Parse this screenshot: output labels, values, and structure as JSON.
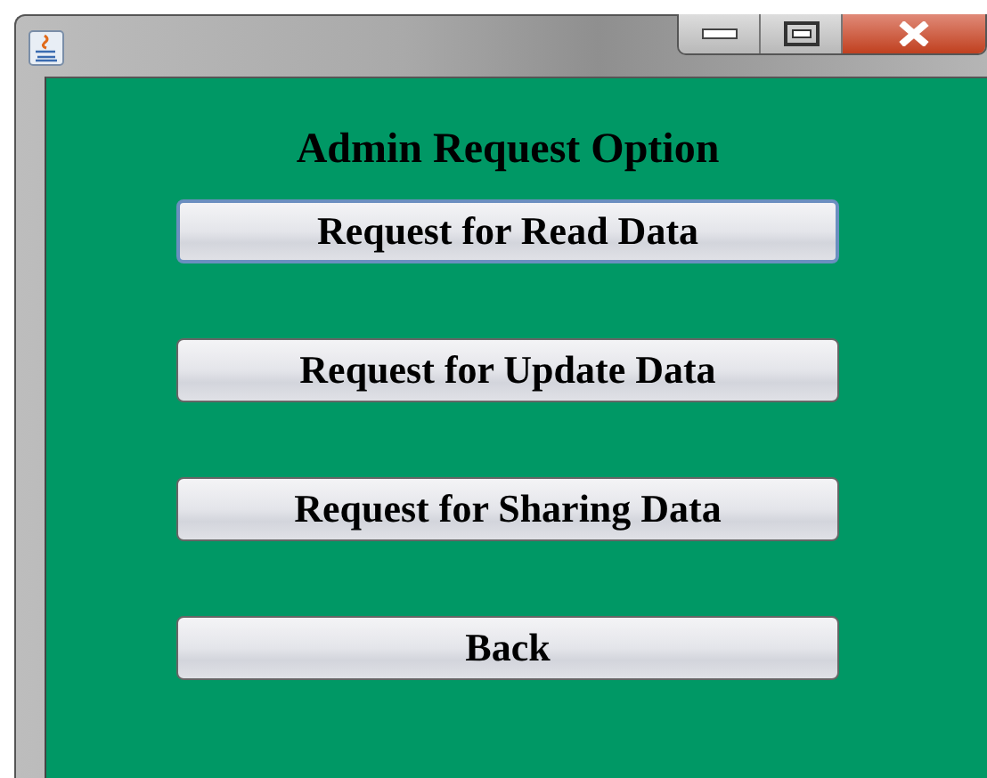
{
  "heading": "Admin Request Option",
  "buttons": [
    {
      "label": "Request for Read Data",
      "focused": true
    },
    {
      "label": "Request for Update Data",
      "focused": false
    },
    {
      "label": "Request for Sharing Data",
      "focused": false
    },
    {
      "label": "Back",
      "focused": false
    }
  ]
}
